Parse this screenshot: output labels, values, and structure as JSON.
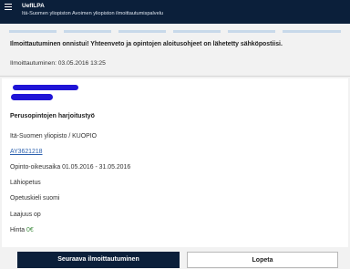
{
  "header": {
    "app_title": "UefILPA",
    "app_subtitle": "Itä-Suomen yliopiston Avoimen yliopiston ilmoittautumispalvelu"
  },
  "confirmation": {
    "message": "Ilmoittautuminen onnistui! Yhteenveto ja opintojen aloitusohjeet on lähetetty sähköpostiisi.",
    "timestamp_text": "Ilmoittautuminen: 03.05.2016 13:25"
  },
  "course": {
    "title": "Perusopintojen harjoitustyö",
    "organizer": "Itä-Suomen yliopisto / KUOPIO",
    "code": "AY3621218",
    "study_period": "Opinto-oikeusaika 01.05.2016 - 31.05.2016",
    "teaching_type": "Lähiopetus",
    "language": "Opetuskieli suomi",
    "credits": "Laajuus op",
    "price_label": "Hinta",
    "price_value": "0€"
  },
  "actions": {
    "next_enrollment": "Seuraava ilmoittautuminen",
    "quit": "Lopeta"
  },
  "colors": {
    "header_bg": "#0b1f3a",
    "link": "#2a5fad",
    "price": "#3c8a3c",
    "redaction": "#1f14d6"
  }
}
